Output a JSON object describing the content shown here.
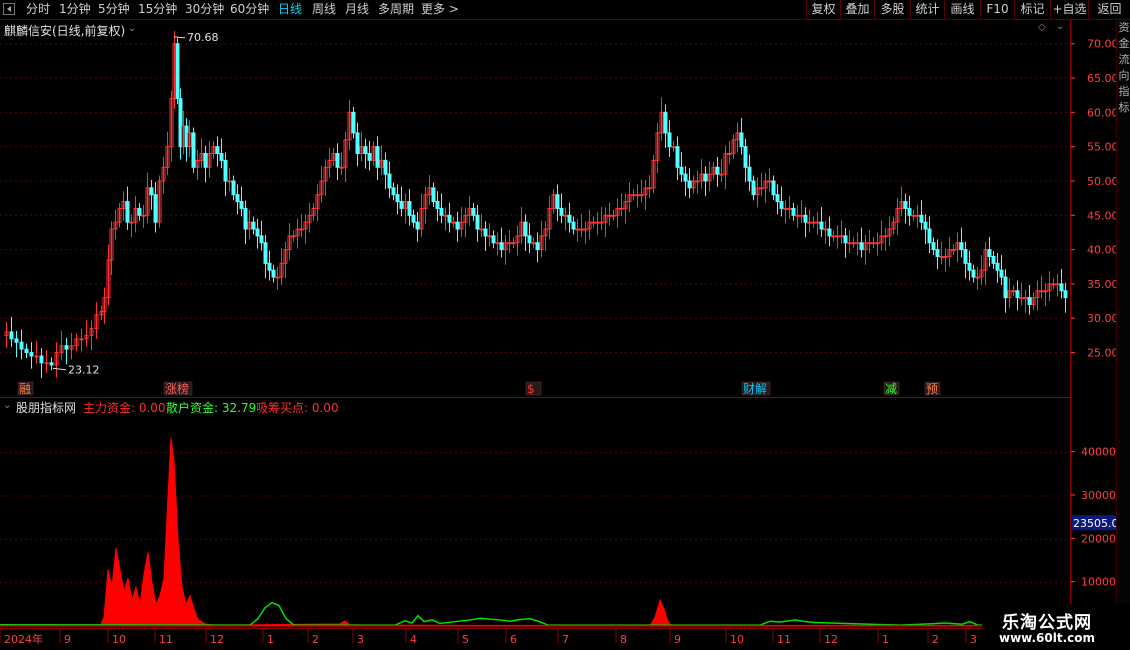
{
  "toolbar": {
    "periods": [
      "分时",
      "1分钟",
      "5分钟",
      "15分钟",
      "30分钟",
      "60分钟",
      "日线",
      "周线",
      "月线",
      "多周期",
      "更多 >"
    ],
    "active_period": "日线",
    "right_buttons": [
      "复权",
      "叠加",
      "多股",
      "统计",
      "画线",
      "F10",
      "标记",
      "+自选",
      "返回"
    ]
  },
  "main": {
    "title": "麒麟信安(日线,前复权)",
    "high_label": "70.68",
    "low_label": "23.12",
    "markers": [
      {
        "label": "融",
        "color": "#ff8040"
      },
      {
        "label": "涨榜",
        "color": "#ff6060"
      },
      {
        "label": "$",
        "color": "#ff3030"
      },
      {
        "label": "财解",
        "color": "#00c8ff"
      },
      {
        "label": "减",
        "color": "#30ff30"
      },
      {
        "label": "预",
        "color": "#ff8040"
      }
    ]
  },
  "indicator": {
    "name": "股朋指标网",
    "fields": [
      {
        "text": "主力资金: 0.00",
        "color": "#ff3030"
      },
      {
        "text": "散户资金: 32.79",
        "color": "#30ff30"
      },
      {
        "text": "吸筹买点: 0.00",
        "color": "#ff3030"
      }
    ],
    "highlight_value": "23505.01"
  },
  "axes": {
    "price_ticks": [
      "70.00",
      "65.00",
      "60.00",
      "55.00",
      "50.00",
      "45.00",
      "40.00",
      "35.00",
      "30.00",
      "25.00"
    ],
    "indicator_ticks": [
      "40000",
      "30000",
      "20000",
      "10000"
    ],
    "date_labels": [
      "2024年",
      "9",
      "10",
      "11",
      "12",
      "1",
      "2",
      "3",
      "4",
      "5",
      "6",
      "7",
      "8",
      "9",
      "10",
      "11",
      "12",
      "1",
      "2",
      "3"
    ]
  },
  "far_strip": "资金流向指标",
  "watermark": {
    "title": "乐淘公式网",
    "url": "www.60lt.com"
  },
  "colors": {
    "up": "#ff3232",
    "down": "#54ffff",
    "fund_main": "#ff0000",
    "fund_retail": "#00e000",
    "grid": "#5a0000",
    "axis": "#ff4040"
  },
  "chart_data": {
    "type": "candlestick",
    "price_range": [
      21,
      72
    ],
    "close_points": [
      [
        0,
        27.5
      ],
      [
        5,
        28
      ],
      [
        10,
        27
      ],
      [
        15,
        26.5
      ],
      [
        20,
        25.5
      ],
      [
        25,
        25
      ],
      [
        30,
        24.5
      ],
      [
        35,
        24.5
      ],
      [
        40,
        23.5
      ],
      [
        45,
        23.5
      ],
      [
        50,
        23.2
      ],
      [
        55,
        25
      ],
      [
        60,
        26
      ],
      [
        65,
        25.5
      ],
      [
        70,
        26
      ],
      [
        75,
        27
      ],
      [
        80,
        27
      ],
      [
        85,
        27.5
      ],
      [
        90,
        28.5
      ],
      [
        95,
        30.5
      ],
      [
        100,
        31
      ],
      [
        103,
        33
      ],
      [
        107,
        38.5
      ],
      [
        110,
        43
      ],
      [
        114,
        44
      ],
      [
        118,
        46
      ],
      [
        122,
        47
      ],
      [
        126,
        44
      ],
      [
        130,
        44
      ],
      [
        134,
        46
      ],
      [
        138,
        45
      ],
      [
        142,
        45
      ],
      [
        146,
        49
      ],
      [
        150,
        48
      ],
      [
        154,
        44
      ],
      [
        158,
        50
      ],
      [
        162,
        52
      ],
      [
        166,
        55
      ],
      [
        170,
        62
      ],
      [
        173,
        70
      ],
      [
        176,
        62
      ],
      [
        179,
        55
      ],
      [
        182,
        58
      ],
      [
        185,
        55
      ],
      [
        188,
        57
      ],
      [
        192,
        52
      ],
      [
        196,
        53
      ],
      [
        200,
        54
      ],
      [
        204,
        52
      ],
      [
        208,
        54
      ],
      [
        212,
        55
      ],
      [
        216,
        54
      ],
      [
        220,
        53
      ],
      [
        224,
        50
      ],
      [
        228,
        50
      ],
      [
        232,
        48
      ],
      [
        236,
        47
      ],
      [
        240,
        46
      ],
      [
        244,
        43
      ],
      [
        248,
        44
      ],
      [
        252,
        43
      ],
      [
        256,
        42
      ],
      [
        260,
        41
      ],
      [
        264,
        38
      ],
      [
        268,
        37
      ],
      [
        272,
        36
      ],
      [
        276,
        36
      ],
      [
        280,
        38
      ],
      [
        284,
        40
      ],
      [
        288,
        42
      ],
      [
        292,
        42
      ],
      [
        296,
        43
      ],
      [
        300,
        43
      ],
      [
        304,
        44
      ],
      [
        308,
        45
      ],
      [
        312,
        46
      ],
      [
        316,
        48
      ],
      [
        320,
        50
      ],
      [
        324,
        52
      ],
      [
        328,
        53
      ],
      [
        332,
        54
      ],
      [
        336,
        52
      ],
      [
        340,
        52
      ],
      [
        344,
        56
      ],
      [
        348,
        60
      ],
      [
        352,
        57
      ],
      [
        356,
        54
      ],
      [
        360,
        55
      ],
      [
        364,
        54
      ],
      [
        368,
        53
      ],
      [
        372,
        55
      ],
      [
        376,
        52
      ],
      [
        380,
        53
      ],
      [
        384,
        51
      ],
      [
        388,
        49
      ],
      [
        392,
        48
      ],
      [
        396,
        47
      ],
      [
        400,
        46
      ],
      [
        404,
        47
      ],
      [
        408,
        45
      ],
      [
        412,
        44
      ],
      [
        416,
        43
      ],
      [
        420,
        46
      ],
      [
        424,
        48
      ],
      [
        428,
        49
      ],
      [
        432,
        47
      ],
      [
        436,
        46
      ],
      [
        440,
        45
      ],
      [
        444,
        45
      ],
      [
        448,
        44
      ],
      [
        452,
        44
      ],
      [
        456,
        43
      ],
      [
        460,
        44
      ],
      [
        464,
        45
      ],
      [
        468,
        46
      ],
      [
        472,
        45
      ],
      [
        476,
        43
      ],
      [
        480,
        43
      ],
      [
        484,
        42
      ],
      [
        488,
        42
      ],
      [
        492,
        41
      ],
      [
        496,
        41
      ],
      [
        500,
        40
      ],
      [
        504,
        41
      ],
      [
        508,
        41
      ],
      [
        512,
        41
      ],
      [
        516,
        42
      ],
      [
        520,
        44
      ],
      [
        524,
        42
      ],
      [
        528,
        41
      ],
      [
        532,
        41
      ],
      [
        536,
        40
      ],
      [
        540,
        42
      ],
      [
        544,
        43
      ],
      [
        548,
        46
      ],
      [
        552,
        48
      ],
      [
        556,
        46
      ],
      [
        560,
        45
      ],
      [
        564,
        45
      ],
      [
        568,
        44
      ],
      [
        572,
        43
      ],
      [
        576,
        43
      ],
      [
        580,
        43
      ],
      [
        584,
        43
      ],
      [
        588,
        44
      ],
      [
        592,
        44
      ],
      [
        596,
        44
      ],
      [
        600,
        44
      ],
      [
        604,
        45
      ],
      [
        608,
        45
      ],
      [
        612,
        45
      ],
      [
        616,
        46
      ],
      [
        620,
        46
      ],
      [
        624,
        47
      ],
      [
        628,
        48
      ],
      [
        632,
        48
      ],
      [
        636,
        48
      ],
      [
        640,
        48
      ],
      [
        644,
        49
      ],
      [
        648,
        49
      ],
      [
        652,
        53
      ],
      [
        656,
        57
      ],
      [
        660,
        60
      ],
      [
        664,
        57
      ],
      [
        668,
        55
      ],
      [
        672,
        55
      ],
      [
        676,
        52
      ],
      [
        680,
        51
      ],
      [
        684,
        50
      ],
      [
        688,
        49
      ],
      [
        692,
        50
      ],
      [
        696,
        50
      ],
      [
        700,
        51
      ],
      [
        704,
        50
      ],
      [
        708,
        51
      ],
      [
        712,
        52
      ],
      [
        716,
        51
      ],
      [
        720,
        51
      ],
      [
        724,
        54
      ],
      [
        728,
        54
      ],
      [
        732,
        56
      ],
      [
        736,
        57
      ],
      [
        740,
        55
      ],
      [
        744,
        52
      ],
      [
        748,
        50
      ],
      [
        752,
        48
      ],
      [
        756,
        49
      ],
      [
        760,
        49
      ],
      [
        764,
        50
      ],
      [
        768,
        50
      ],
      [
        772,
        48
      ],
      [
        776,
        47
      ],
      [
        780,
        46
      ],
      [
        784,
        46
      ],
      [
        788,
        46
      ],
      [
        792,
        45
      ],
      [
        796,
        45
      ],
      [
        800,
        45
      ],
      [
        804,
        44
      ],
      [
        808,
        44
      ],
      [
        812,
        44
      ],
      [
        816,
        44
      ],
      [
        820,
        43
      ],
      [
        824,
        43
      ],
      [
        828,
        42
      ],
      [
        832,
        42
      ],
      [
        836,
        42
      ],
      [
        840,
        42
      ],
      [
        844,
        41
      ],
      [
        848,
        41
      ],
      [
        852,
        41
      ],
      [
        856,
        41
      ],
      [
        860,
        40
      ],
      [
        864,
        41
      ],
      [
        868,
        41
      ],
      [
        872,
        41
      ],
      [
        876,
        41
      ],
      [
        880,
        42
      ],
      [
        884,
        42
      ],
      [
        888,
        43
      ],
      [
        892,
        44
      ],
      [
        896,
        46
      ],
      [
        900,
        47
      ],
      [
        904,
        46
      ],
      [
        908,
        45
      ],
      [
        912,
        45
      ],
      [
        916,
        45
      ],
      [
        920,
        44
      ],
      [
        924,
        43
      ],
      [
        928,
        41
      ],
      [
        932,
        40
      ],
      [
        936,
        39
      ],
      [
        940,
        39
      ],
      [
        944,
        39
      ],
      [
        948,
        40
      ],
      [
        952,
        40
      ],
      [
        956,
        41
      ],
      [
        960,
        40
      ],
      [
        964,
        38
      ],
      [
        968,
        37
      ],
      [
        972,
        36
      ],
      [
        976,
        36
      ],
      [
        980,
        37
      ],
      [
        984,
        40
      ],
      [
        988,
        39
      ],
      [
        992,
        38
      ],
      [
        996,
        37
      ],
      [
        1000,
        36
      ],
      [
        1004,
        33
      ],
      [
        1008,
        34
      ],
      [
        1012,
        34
      ],
      [
        1016,
        33
      ],
      [
        1020,
        33
      ],
      [
        1024,
        33
      ],
      [
        1028,
        32
      ],
      [
        1032,
        33
      ],
      [
        1036,
        34
      ],
      [
        1040,
        34
      ],
      [
        1044,
        34
      ],
      [
        1048,
        35
      ],
      [
        1052,
        35
      ],
      [
        1056,
        35
      ],
      [
        1060,
        34
      ],
      [
        1064,
        33
      ]
    ],
    "main_fund_peaks": [
      [
        100,
        0
      ],
      [
        104,
        2000
      ],
      [
        108,
        13000
      ],
      [
        112,
        9000
      ],
      [
        116,
        18000
      ],
      [
        120,
        13000
      ],
      [
        124,
        8000
      ],
      [
        128,
        11000
      ],
      [
        132,
        6000
      ],
      [
        136,
        9000
      ],
      [
        140,
        5000
      ],
      [
        144,
        12000
      ],
      [
        148,
        17000
      ],
      [
        152,
        10000
      ],
      [
        156,
        5000
      ],
      [
        160,
        7000
      ],
      [
        164,
        11000
      ],
      [
        168,
        30000
      ],
      [
        171,
        43500
      ],
      [
        174,
        38000
      ],
      [
        178,
        20000
      ],
      [
        182,
        9000
      ],
      [
        186,
        5000
      ],
      [
        190,
        7000
      ],
      [
        194,
        4000
      ],
      [
        198,
        1500
      ],
      [
        205,
        500
      ],
      [
        215,
        200
      ],
      [
        340,
        500
      ],
      [
        345,
        1200
      ],
      [
        350,
        300
      ],
      [
        365,
        200
      ],
      [
        650,
        0
      ],
      [
        655,
        2000
      ],
      [
        660,
        6000
      ],
      [
        664,
        4000
      ],
      [
        668,
        1000
      ],
      [
        672,
        0
      ]
    ],
    "retail_fund_peaks": [
      [
        250,
        0
      ],
      [
        258,
        1500
      ],
      [
        265,
        4000
      ],
      [
        272,
        5200
      ],
      [
        279,
        4500
      ],
      [
        286,
        1500
      ],
      [
        294,
        0
      ],
      [
        395,
        0
      ],
      [
        405,
        1000
      ],
      [
        412,
        500
      ],
      [
        418,
        2200
      ],
      [
        424,
        800
      ],
      [
        432,
        1200
      ],
      [
        440,
        400
      ],
      [
        470,
        1200
      ],
      [
        480,
        1600
      ],
      [
        490,
        1400
      ],
      [
        500,
        1200
      ],
      [
        510,
        900
      ],
      [
        520,
        1300
      ],
      [
        530,
        1500
      ],
      [
        540,
        800
      ],
      [
        548,
        0
      ],
      [
        760,
        0
      ],
      [
        770,
        900
      ],
      [
        780,
        700
      ],
      [
        795,
        1200
      ],
      [
        805,
        800
      ],
      [
        815,
        600
      ],
      [
        830,
        500
      ],
      [
        900,
        0
      ],
      [
        930,
        300
      ],
      [
        945,
        500
      ],
      [
        962,
        200
      ],
      [
        970,
        800
      ],
      [
        978,
        0
      ]
    ],
    "ylim_indicator": [
      0,
      48000
    ]
  }
}
